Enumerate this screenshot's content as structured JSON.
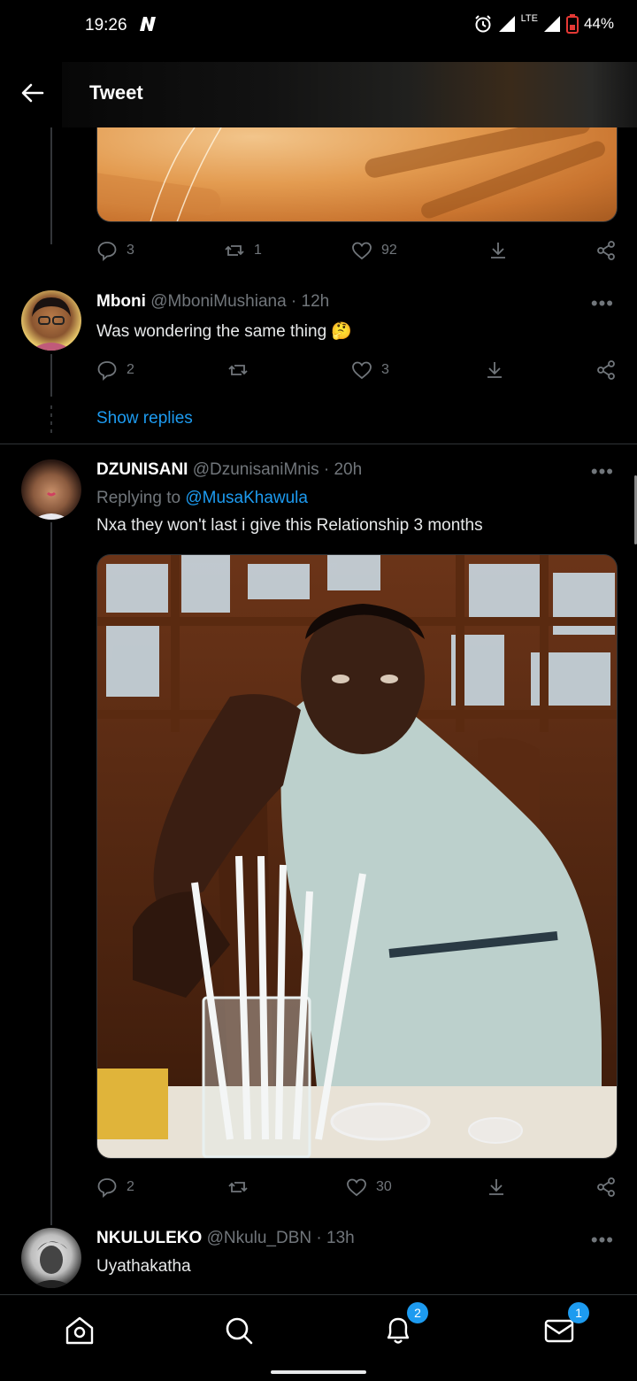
{
  "status_bar": {
    "time": "19:26",
    "network": "LTE",
    "battery": "44%"
  },
  "header": {
    "title": "Tweet"
  },
  "top_tweet_actions": {
    "replies": "3",
    "retweets": "1",
    "likes": "92"
  },
  "replies": [
    {
      "name": "Mboni",
      "handle": "@MboniMushiana",
      "time": "12h",
      "text": "Was wondering the same thing 🤔",
      "reply_count": "2",
      "retweet_count": "",
      "like_count": "3",
      "show_replies": "Show replies"
    },
    {
      "name": "DZUNISANI",
      "handle": "@DzunisaniMnis",
      "time": "20h",
      "replying_prefix": "Replying to",
      "replying_to": "@MusaKhawula",
      "text": "Nxa they won't last i give this Relationship 3 months",
      "reply_count": "2",
      "retweet_count": "",
      "like_count": "30"
    },
    {
      "name": "NKULULEKO",
      "handle": "@Nkulu_DBN",
      "time": "13h",
      "text": "Uyathakatha"
    }
  ],
  "bottom_nav": {
    "notifications_badge": "2",
    "messages_badge": "1"
  },
  "colors": {
    "accent": "#1d9bf0",
    "background": "#000000",
    "muted": "#71767b"
  }
}
